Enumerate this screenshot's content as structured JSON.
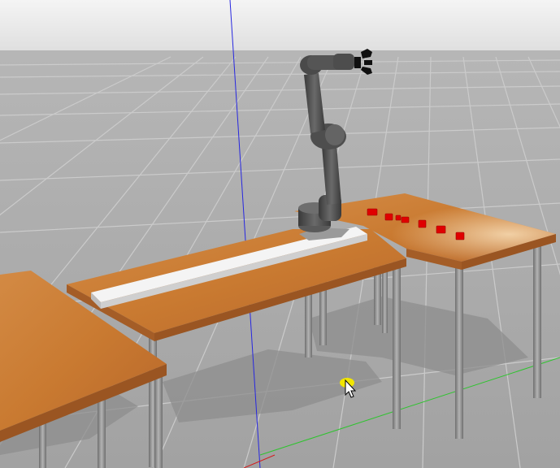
{
  "viewport": {
    "sky_color": "#e8e8e8",
    "ground_color": "#a8a8a8",
    "grid_color": "#c9c9c9"
  },
  "scene": {
    "table_top_color": "#c9782f",
    "table_leg_color": "#8c8c8c",
    "rail_color": "#f2f2f2",
    "robot_color": "#4e4e4e",
    "block_color": "#e00000",
    "blocks_count": 7,
    "axis_colors": {
      "x": "#d21e1e",
      "y": "#2ec42e",
      "z": "#2727e0"
    }
  },
  "cursor": {
    "icon": "mouse-pointer-icon",
    "highlight_color": "#f2e600"
  }
}
